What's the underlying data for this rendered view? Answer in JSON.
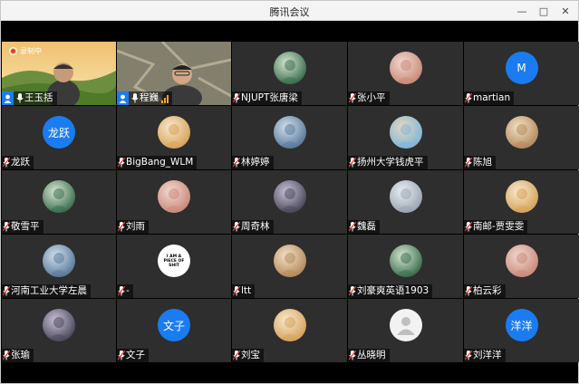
{
  "window": {
    "title": "腾讯会议"
  },
  "tiles": [
    {
      "name": "王玉括",
      "kind": "video-landscape",
      "host": true
    },
    {
      "name": "程巍",
      "kind": "video-map",
      "host": true
    },
    {
      "name": "NJUPT张唐梁",
      "kind": "photo"
    },
    {
      "name": "张小平",
      "kind": "photo"
    },
    {
      "name": "martian",
      "kind": "text",
      "avatar_text": "M"
    },
    {
      "name": "龙跃",
      "kind": "text",
      "avatar_text": "龙跃"
    },
    {
      "name": "BigBang_WLM",
      "kind": "photo"
    },
    {
      "name": "林婷婷",
      "kind": "photo"
    },
    {
      "name": "扬州大学钱虎平",
      "kind": "photo"
    },
    {
      "name": "陈旭",
      "kind": "photo"
    },
    {
      "name": "敬雪平",
      "kind": "photo"
    },
    {
      "name": "刘雨",
      "kind": "photo"
    },
    {
      "name": "周奇林",
      "kind": "photo"
    },
    {
      "name": "魏磊",
      "kind": "photo"
    },
    {
      "name": "南邮-贾雯雯",
      "kind": "photo"
    },
    {
      "name": "河南工业大学左晨",
      "kind": "photo"
    },
    {
      "name": "-",
      "kind": "text-card",
      "avatar_text": "I AM A PIECE OF SHIT"
    },
    {
      "name": "ltt",
      "kind": "photo"
    },
    {
      "name": "刘豪爽英语1903",
      "kind": "photo"
    },
    {
      "name": "柏云彩",
      "kind": "photo"
    },
    {
      "name": "张瑜",
      "kind": "photo"
    },
    {
      "name": "文子",
      "kind": "text",
      "avatar_text": "文子"
    },
    {
      "name": "刘宝",
      "kind": "photo"
    },
    {
      "name": "丛晓明",
      "kind": "person-placeholder"
    },
    {
      "name": "刘洋洋",
      "kind": "text",
      "avatar_text": "洋洋"
    }
  ],
  "recording": {
    "label": "录制中"
  },
  "colors": {
    "accent": "#1a7cf0",
    "tile_bg": "#2e2e2e",
    "record": "#e53935",
    "signal": "#f5a623"
  }
}
